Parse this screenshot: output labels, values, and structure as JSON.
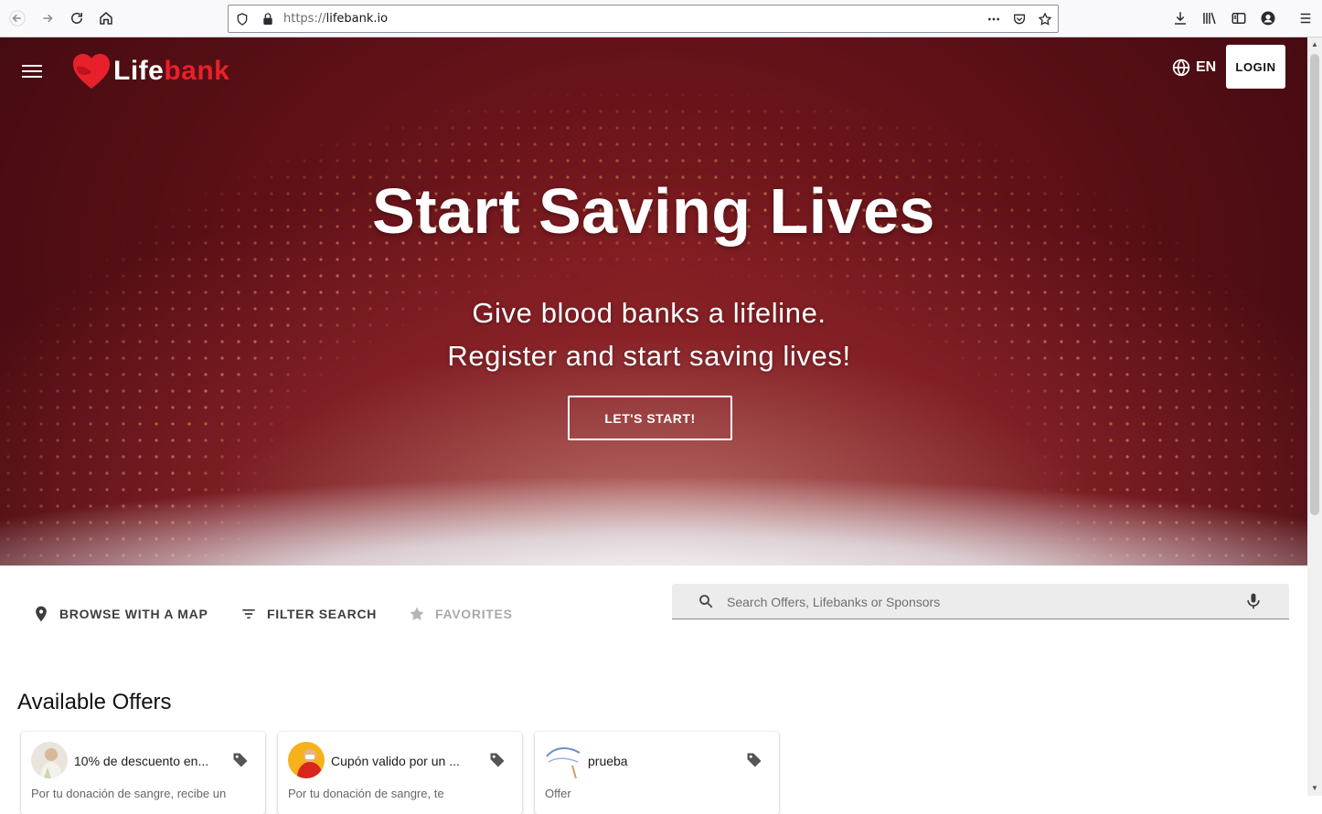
{
  "browser": {
    "url_scheme": "https://",
    "url_host": "lifebank.io"
  },
  "header": {
    "brand_part1": "Life",
    "brand_part2": "bank",
    "language": "EN",
    "login_label": "LOGIN"
  },
  "hero": {
    "title": "Start Saving Lives",
    "subtitle_line1": "Give blood banks a lifeline.",
    "subtitle_line2": "Register and start saving lives!",
    "cta_label": "LET'S START!"
  },
  "toolbar": {
    "browse_map": "BROWSE WITH A MAP",
    "filter_search": "FILTER SEARCH",
    "favorites": "FAVORITES",
    "search_placeholder": "Search Offers, Lifebanks or Sponsors"
  },
  "offers": {
    "section_title": "Available Offers",
    "items": [
      {
        "title": "10% de descuento en...",
        "description": "Por tu donación de sangre, recibe un"
      },
      {
        "title": "Cupón valido por un ...",
        "description": "Por tu donación de sangre, te"
      },
      {
        "title": "prueba",
        "description": "Offer"
      }
    ]
  },
  "colors": {
    "brand_red": "#e8202b",
    "hero_dark": "#5a0f16"
  }
}
